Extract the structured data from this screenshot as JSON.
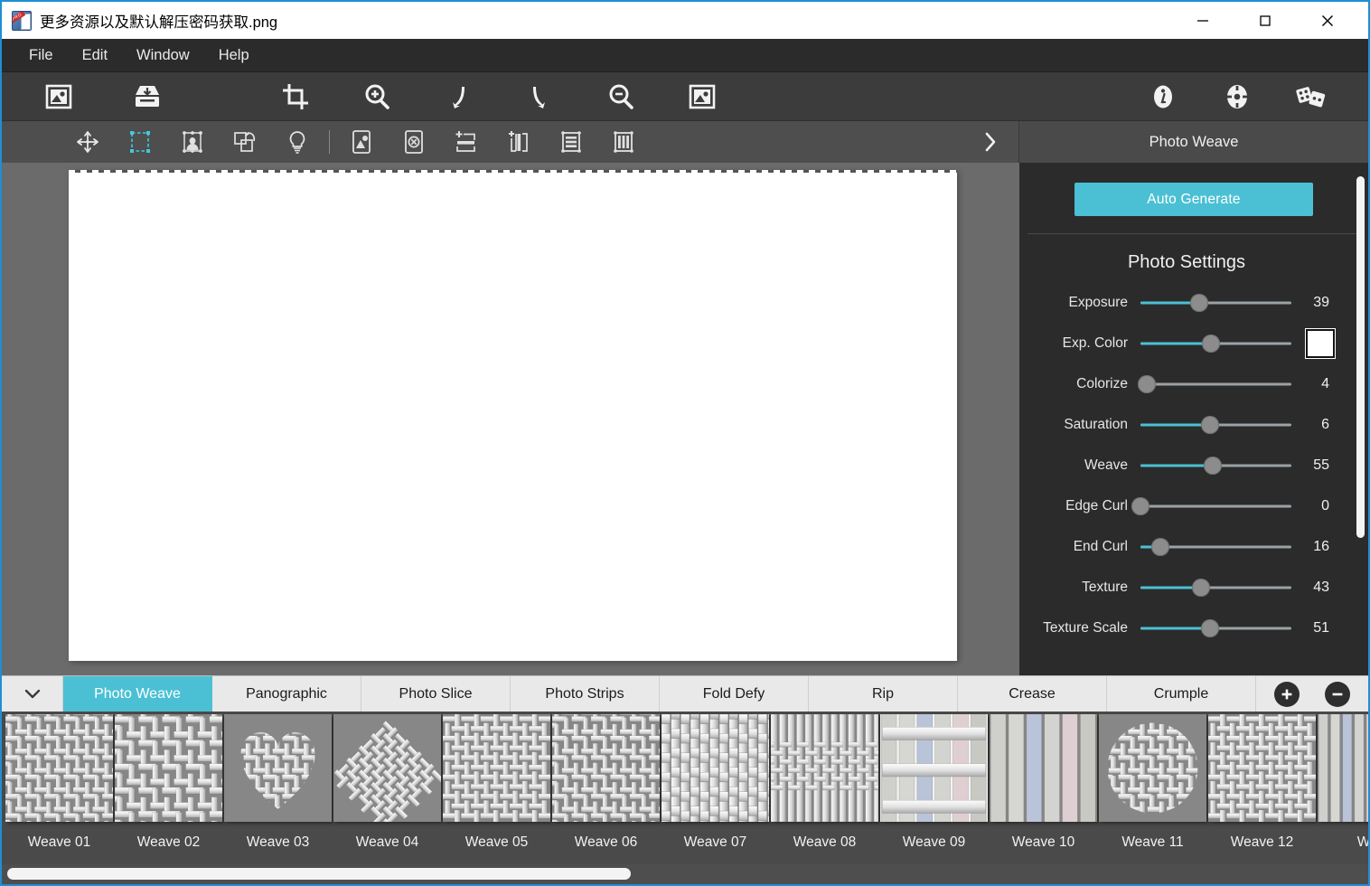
{
  "window": {
    "title": "更多资源以及默认解压密码获取.png",
    "icon": "app-icon",
    "controls": {
      "minimize": "minimize-icon",
      "maximize": "maximize-icon",
      "close": "close-icon"
    },
    "accent": "#1e8fd5"
  },
  "menu": {
    "items": [
      "File",
      "Edit",
      "Window",
      "Help"
    ]
  },
  "toolbar": {
    "left": [
      {
        "name": "open-image-icon",
        "tooltip": "Open Image"
      },
      {
        "name": "save-image-icon",
        "tooltip": "Save Image"
      }
    ],
    "center": [
      {
        "name": "crop-icon",
        "tooltip": "Crop"
      },
      {
        "name": "zoom-in-icon",
        "tooltip": "Zoom In"
      },
      {
        "name": "undo-icon",
        "tooltip": "Undo"
      },
      {
        "name": "redo-icon",
        "tooltip": "Redo"
      },
      {
        "name": "zoom-out-icon",
        "tooltip": "Zoom Out"
      },
      {
        "name": "fit-image-icon",
        "tooltip": "Fit Image"
      }
    ],
    "right": [
      {
        "name": "info-icon",
        "tooltip": "Info"
      },
      {
        "name": "settings-icon",
        "tooltip": "Settings"
      },
      {
        "name": "random-dice-icon",
        "tooltip": "Randomize"
      }
    ]
  },
  "subtoolbar": {
    "tools": [
      {
        "name": "move-tool-icon",
        "active": false
      },
      {
        "name": "rectangle-select-icon",
        "active": true
      },
      {
        "name": "portrait-select-icon",
        "active": false
      },
      {
        "name": "transform-rotate-icon",
        "active": false
      },
      {
        "name": "light-bulb-icon",
        "active": false
      }
    ],
    "options": [
      {
        "name": "add-image-icon"
      },
      {
        "name": "remove-image-icon"
      },
      {
        "name": "add-horizontal-icon"
      },
      {
        "name": "add-vertical-icon"
      },
      {
        "name": "horizontal-bars-icon"
      },
      {
        "name": "vertical-bars-icon"
      }
    ],
    "expand": "chevron-right-icon",
    "panel_title": "Photo Weave"
  },
  "panel": {
    "auto_generate_label": "Auto Generate",
    "section_title": "Photo Settings",
    "accent_color": "#4bc0d4",
    "sliders": [
      {
        "label": "Exposure",
        "value": "39",
        "percent": 39,
        "type": "value"
      },
      {
        "label": "Exp. Color",
        "value": "",
        "percent": 47,
        "type": "swatch",
        "swatch_color": "#ffffff"
      },
      {
        "label": "Colorize",
        "value": "4",
        "percent": 4,
        "type": "value"
      },
      {
        "label": "Saturation",
        "value": "6",
        "percent": 46,
        "type": "value"
      },
      {
        "label": "Weave",
        "value": "55",
        "percent": 48,
        "type": "value"
      },
      {
        "label": "Edge Curl",
        "value": "0",
        "percent": 0,
        "type": "value"
      },
      {
        "label": "End Curl",
        "value": "16",
        "percent": 13,
        "type": "value"
      },
      {
        "label": "Texture",
        "value": "43",
        "percent": 40,
        "type": "value"
      },
      {
        "label": "Texture Scale",
        "value": "51",
        "percent": 46,
        "type": "value"
      }
    ]
  },
  "tabs": {
    "collapse_icon": "chevron-down-icon",
    "items": [
      {
        "label": "Photo Weave",
        "active": true
      },
      {
        "label": "Panographic",
        "active": false
      },
      {
        "label": "Photo Slice",
        "active": false
      },
      {
        "label": "Photo Strips",
        "active": false
      },
      {
        "label": "Fold Defy",
        "active": false
      },
      {
        "label": "Rip",
        "active": false
      },
      {
        "label": "Crease",
        "active": false
      },
      {
        "label": "Crumple",
        "active": false
      }
    ],
    "add_icon": "plus-circle-icon",
    "remove_icon": "minus-circle-icon"
  },
  "thumbnails": [
    {
      "label": "Weave 01",
      "pattern": "diagonal-twill",
      "selected": false
    },
    {
      "label": "Weave 02",
      "pattern": "diagonal-sparse",
      "selected": false
    },
    {
      "label": "Weave 03",
      "pattern": "heart-mask",
      "selected": false
    },
    {
      "label": "Weave 04",
      "pattern": "rotated-basket",
      "selected": false
    },
    {
      "label": "Weave 05",
      "pattern": "plain-basket",
      "selected": false
    },
    {
      "label": "Weave 06",
      "pattern": "dense-twill",
      "selected": false
    },
    {
      "label": "Weave 07",
      "pattern": "herringbone",
      "selected": false
    },
    {
      "label": "Weave 08",
      "pattern": "vertical-weave",
      "selected": false
    },
    {
      "label": "Weave 09",
      "pattern": "wide-strips",
      "selected": true
    },
    {
      "label": "Weave 10",
      "pattern": "vertical-strips",
      "selected": false
    },
    {
      "label": "Weave 11",
      "pattern": "circle-mask",
      "selected": false
    },
    {
      "label": "Weave 12",
      "pattern": "grid-basket",
      "selected": false
    },
    {
      "label": "Wea",
      "pattern": "narrow-strips",
      "selected": false
    }
  ]
}
